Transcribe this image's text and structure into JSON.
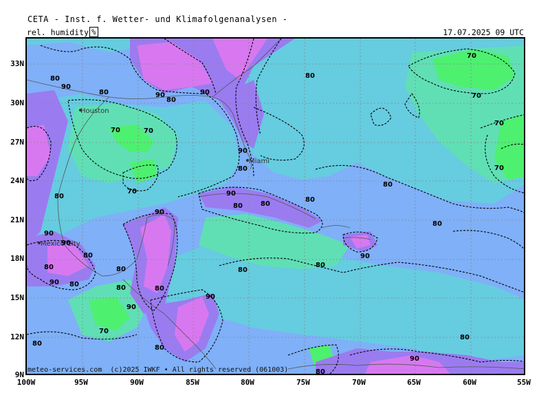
{
  "header": {
    "title": "CETA - Inst. f. Wetter- und Klimafolgenanalysen -",
    "parameter": "rel. humidity",
    "unit": "%",
    "datetime": "17.07.2025 09 UTC"
  },
  "map": {
    "lat_labels": [
      "33N",
      "30N",
      "27N",
      "24N",
      "21N",
      "18N",
      "15N",
      "12N",
      "9N"
    ],
    "lon_labels": [
      "100W",
      "95W",
      "90W",
      "85W",
      "80W",
      "75W",
      "70W",
      "65W",
      "60W",
      "55W"
    ],
    "cities": [
      "Houston",
      "Miami",
      "Mexico City"
    ],
    "contour_values": [
      "70",
      "80",
      "90"
    ],
    "colors": {
      "humid_90": "#d878f0",
      "humid_85": "#9a7cf0",
      "humid_80": "#7fb0f8",
      "humid_75": "#66cce0",
      "humid_70": "#60dfb5",
      "humid_65": "#4ef070",
      "grid": "#888888"
    }
  },
  "copyright": "meteo-services.com  (c)2025 IWKF • All rights reserved (061003)"
}
